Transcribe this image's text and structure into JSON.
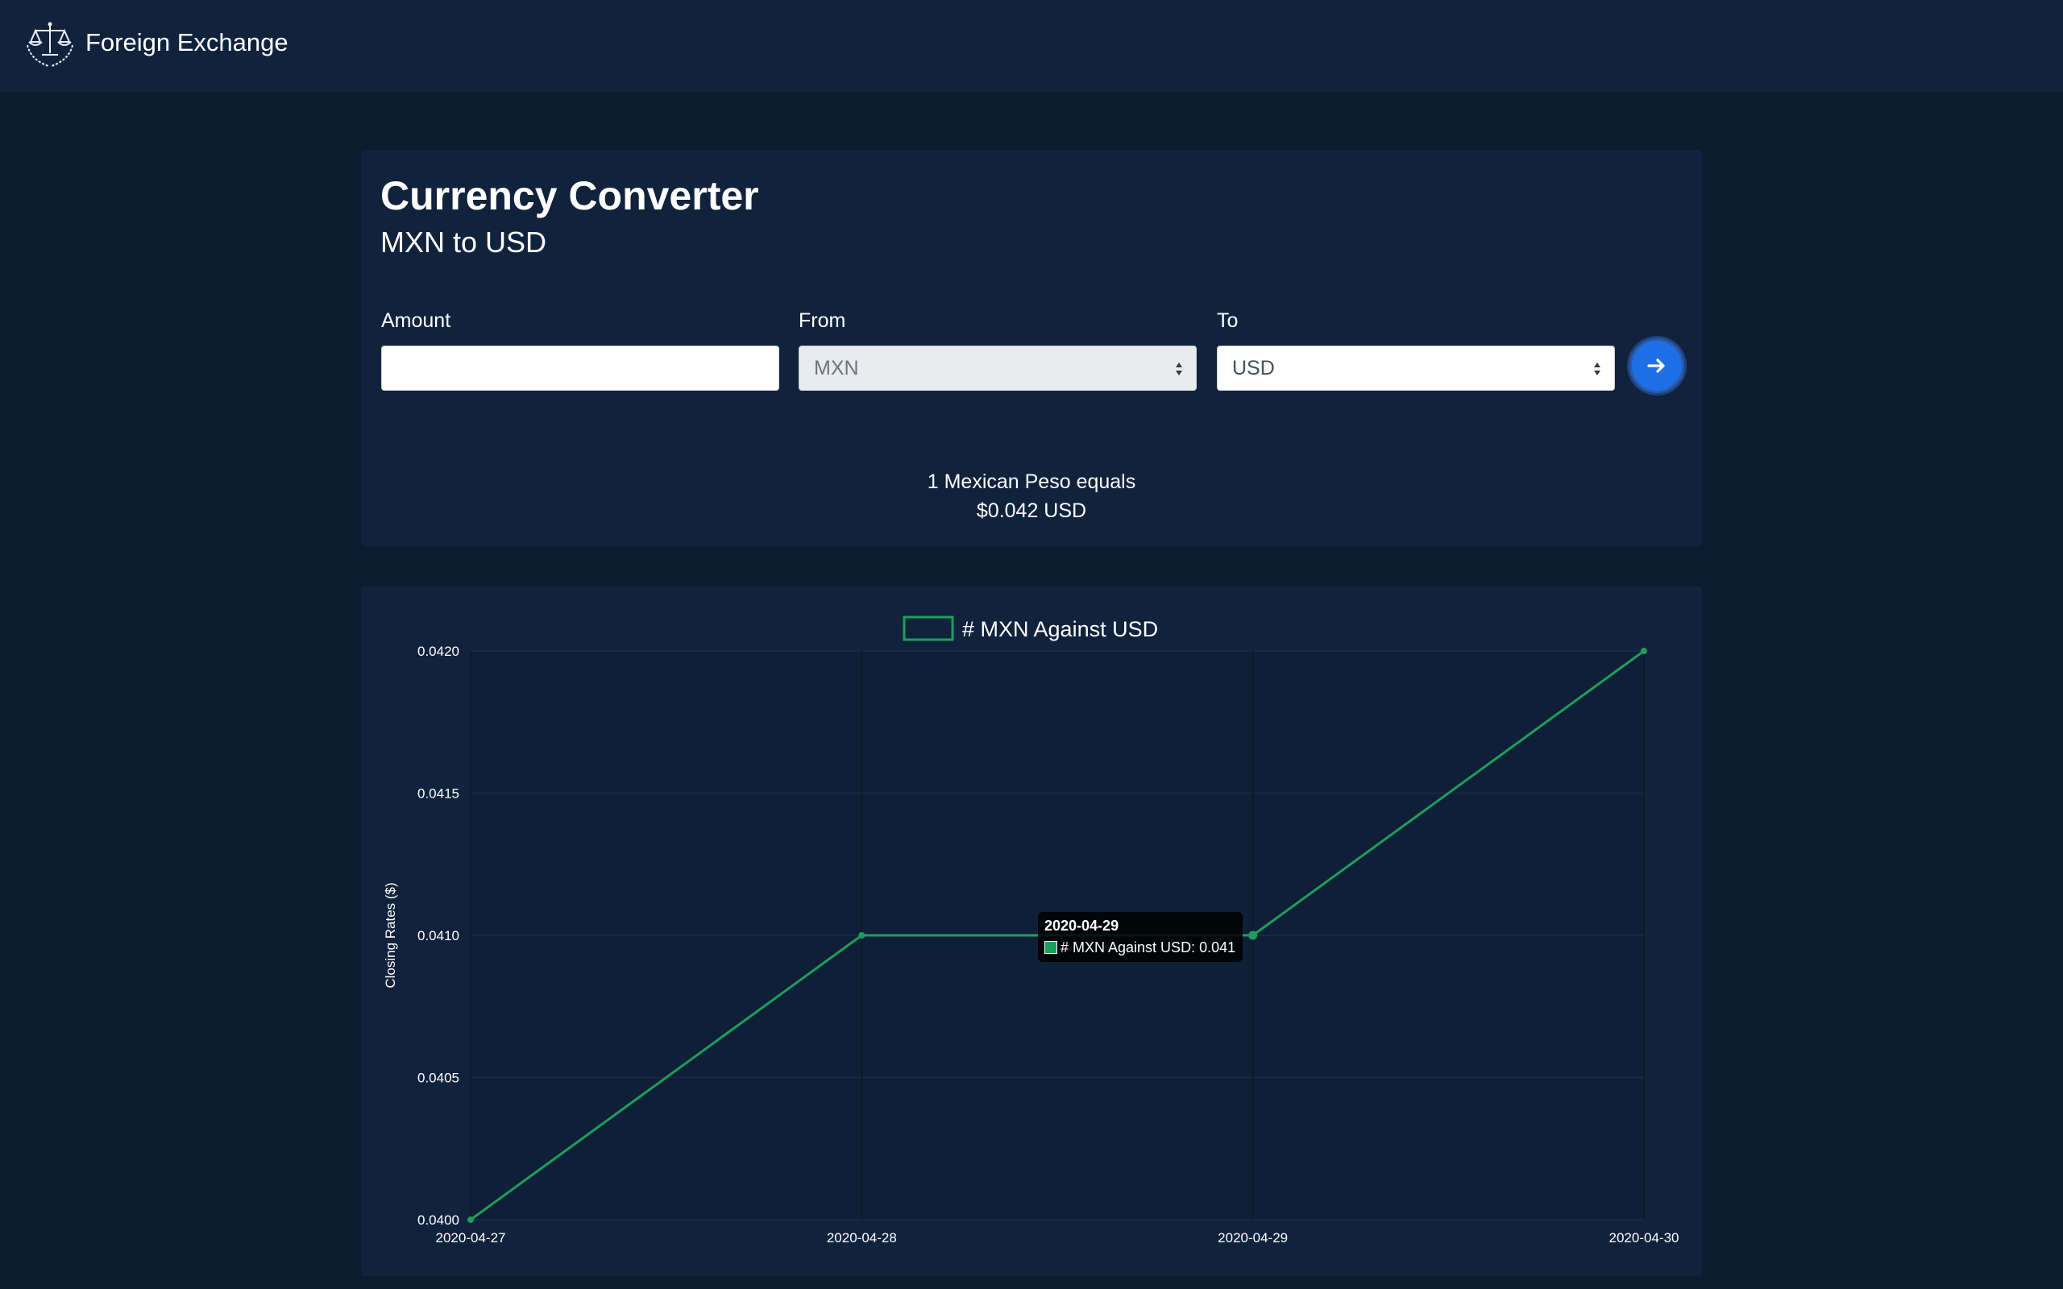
{
  "navbar": {
    "brand": "Foreign Exchange",
    "logo_icon": "scales-of-justice-icon"
  },
  "converter": {
    "title": "Currency Converter",
    "subtitle": "MXN to USD",
    "amount_label": "Amount",
    "amount_value": "",
    "from_label": "From",
    "from_value": "MXN",
    "to_label": "To",
    "to_value": "USD",
    "go_icon": "arrow-right-icon",
    "result_line1": "1 Mexican Peso equals",
    "result_line2": "$0.042 USD",
    "accent_color": "#1e6fe6"
  },
  "chart_data": {
    "type": "line",
    "x": [
      "2020-04-27",
      "2020-04-28",
      "2020-04-29",
      "2020-04-30"
    ],
    "series": [
      {
        "name": "# MXN Against USD",
        "values": [
          0.04,
          0.041,
          0.041,
          0.042
        ],
        "color": "#1e9e5a"
      }
    ],
    "ylabel": "Closing Rates ($)",
    "xlabel": "",
    "ylim": [
      0.04,
      0.042
    ],
    "yticks": [
      "0.0420",
      "0.0415",
      "0.0410",
      "0.0405",
      "0.0400"
    ],
    "legend_position": "top-center",
    "grid": true,
    "tooltip": {
      "title": "2020-04-29",
      "text": "# MXN Against USD: 0.041"
    }
  }
}
